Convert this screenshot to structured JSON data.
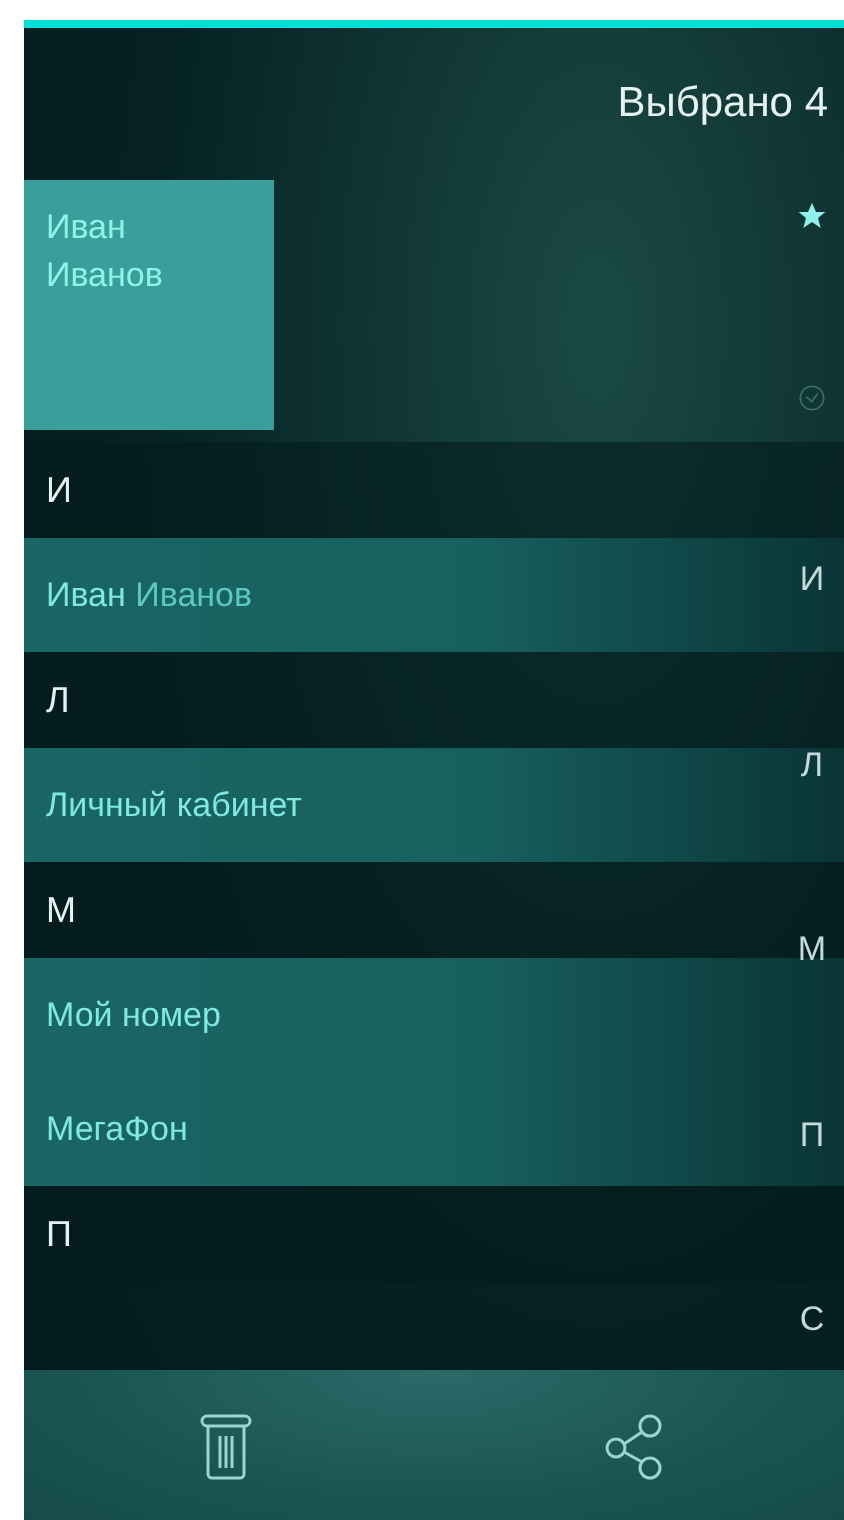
{
  "header": {
    "title": "Выбрано 4"
  },
  "favorites": [
    {
      "first": "Иван",
      "last": "Иванов",
      "selected": true
    }
  ],
  "sections": [
    {
      "letter": "И",
      "contacts": [
        {
          "first": "Иван",
          "last": "Иванов",
          "selected": true
        }
      ]
    },
    {
      "letter": "Л",
      "contacts": [
        {
          "first": "Личный кабинет",
          "selected": true
        }
      ]
    },
    {
      "letter": "М",
      "contacts": [
        {
          "first": "Мой номер",
          "selected": true
        },
        {
          "first": "МегаФон",
          "selected": true
        }
      ]
    },
    {
      "letter": "П"
    }
  ],
  "index": [
    {
      "kind": "favorites"
    },
    {
      "kind": "recent"
    },
    {
      "kind": "letter",
      "label": "И"
    },
    {
      "kind": "letter",
      "label": "Л"
    },
    {
      "kind": "letter",
      "label": "М"
    },
    {
      "kind": "letter",
      "label": "П"
    },
    {
      "kind": "letter",
      "label": "С"
    }
  ],
  "toolbar": [
    {
      "kind": "delete"
    },
    {
      "kind": "share"
    }
  ]
}
